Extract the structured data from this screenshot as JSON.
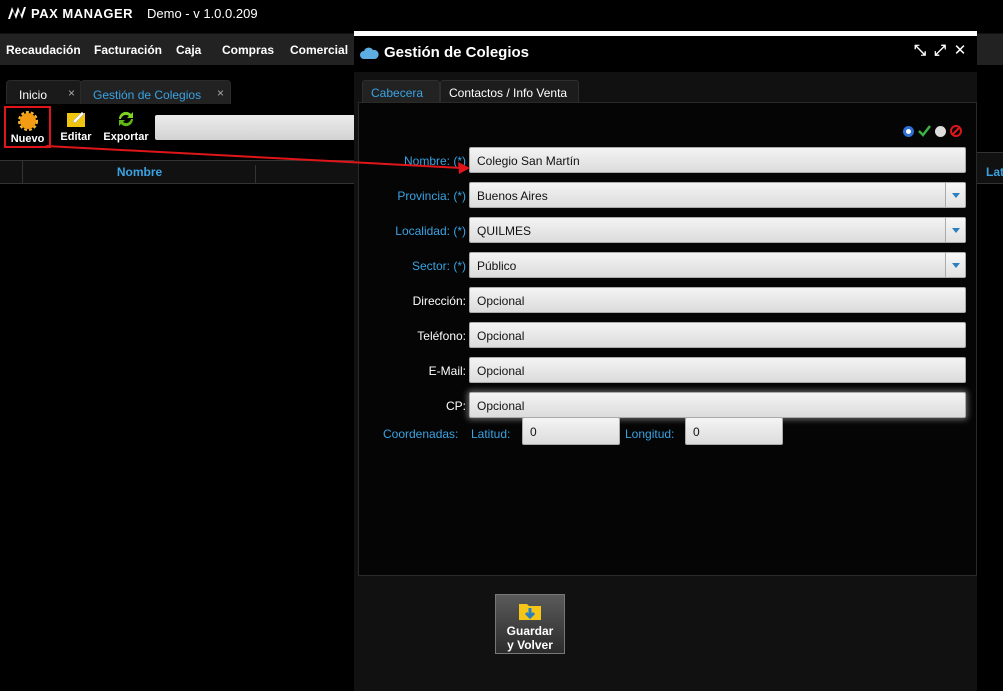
{
  "app": {
    "brand": "PAX MANAGER",
    "version": "Demo - v 1.0.0.209"
  },
  "menu": [
    "Recaudación",
    "Facturación",
    "Caja",
    "Compras",
    "Comercial"
  ],
  "tabs": [
    {
      "label": "Inicio",
      "close": "×"
    },
    {
      "label": "Gestión de Colegios",
      "close": "×"
    }
  ],
  "toolbar": {
    "nuevo": "Nuevo",
    "editar": "Editar",
    "exportar": "Exportar"
  },
  "grid": {
    "column_nombre": "Nombre",
    "column_lat": "Lat"
  },
  "dialog": {
    "title": "Gestión de Colegios",
    "tabs": [
      "Cabecera",
      "Contactos / Info Venta"
    ],
    "fields": {
      "nombre": {
        "label": "Nombre: (*)",
        "value": "Colegio San Martín"
      },
      "provincia": {
        "label": "Provincia: (*)",
        "value": "Buenos Aires"
      },
      "localidad": {
        "label": "Localidad: (*)",
        "value": "QUILMES"
      },
      "sector": {
        "label": "Sector: (*)",
        "value": "Público"
      },
      "direccion": {
        "label": "Dirección:",
        "value": "Opcional"
      },
      "telefono": {
        "label": "Teléfono:",
        "value": "Opcional"
      },
      "email": {
        "label": "E-Mail:",
        "value": "Opcional"
      },
      "cp": {
        "label": "CP:",
        "value": "Opcional"
      }
    },
    "coords": {
      "label": "Coordenadas:",
      "latitud_label": "Latitud:",
      "latitud": "0",
      "longitud_label": "Longitud:",
      "longitud": "0"
    },
    "save": {
      "line1": "Guardar",
      "line2": "y Volver"
    }
  },
  "colors": {
    "accent": "#3aa3e3",
    "highlight": "#e0151a"
  }
}
